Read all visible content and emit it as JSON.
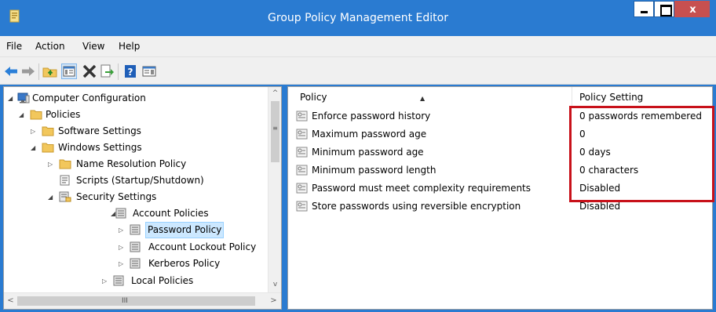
{
  "window": {
    "title": "Group Policy Management Editor"
  },
  "title_buttons": {
    "close_glyph": "x"
  },
  "menu": [
    "File",
    "Action",
    "View",
    "Help"
  ],
  "toolbar": {
    "icons": [
      "back-arrow-icon",
      "forward-arrow-icon",
      "up-folder-icon",
      "show-hide-console-tree-icon",
      "delete-icon",
      "export-list-icon",
      "help-icon",
      "show-hide-action-pane-icon"
    ]
  },
  "tree": {
    "items": [
      {
        "label": "Computer Configuration",
        "expander": "open",
        "icon": "computer-icon"
      },
      {
        "label": "Policies",
        "expander": "open",
        "icon": "folder-icon"
      },
      {
        "label": "Software Settings",
        "expander": "closed",
        "icon": "folder-icon"
      },
      {
        "label": "Windows Settings",
        "expander": "open",
        "icon": "folder-icon"
      },
      {
        "label": "Name Resolution Policy",
        "expander": "closed",
        "icon": "folder-icon"
      },
      {
        "label": "Scripts (Startup/Shutdown)",
        "expander": "none",
        "icon": "script-icon"
      },
      {
        "label": "Security Settings",
        "expander": "open",
        "icon": "security-settings-icon"
      },
      {
        "label": "Account Policies",
        "expander": "open",
        "icon": "policy-container-icon"
      },
      {
        "label": "Password Policy",
        "expander": "closed",
        "icon": "policy-container-icon",
        "selected": true
      },
      {
        "label": "Account Lockout Policy",
        "expander": "closed",
        "icon": "policy-container-icon"
      },
      {
        "label": "Kerberos Policy",
        "expander": "closed",
        "icon": "policy-container-icon"
      },
      {
        "label": "Local Policies",
        "expander": "closed",
        "icon": "policy-container-icon"
      }
    ],
    "scroll_glyphs": {
      "up": "^",
      "down": "v",
      "left": "<",
      "right": ">",
      "grip_h": "III",
      "grip_v": "≡"
    }
  },
  "table": {
    "columns": [
      "Policy",
      "Policy Setting"
    ],
    "sort_glyph": "▲",
    "rows": [
      {
        "policy": "Enforce password history",
        "setting": "0 passwords remembered"
      },
      {
        "policy": "Maximum password age",
        "setting": "0"
      },
      {
        "policy": "Minimum password age",
        "setting": "0 days"
      },
      {
        "policy": "Minimum password length",
        "setting": "0 characters"
      },
      {
        "policy": "Password must meet complexity requirements",
        "setting": "Disabled"
      },
      {
        "policy": "Store passwords using reversible encryption",
        "setting": "Disabled"
      }
    ]
  },
  "colors": {
    "titlebar": "#2a7bd1",
    "close_button": "#c75050",
    "selection": "#cce8ff",
    "highlight_box": "#c8111a",
    "folder": "#f2c75c"
  }
}
